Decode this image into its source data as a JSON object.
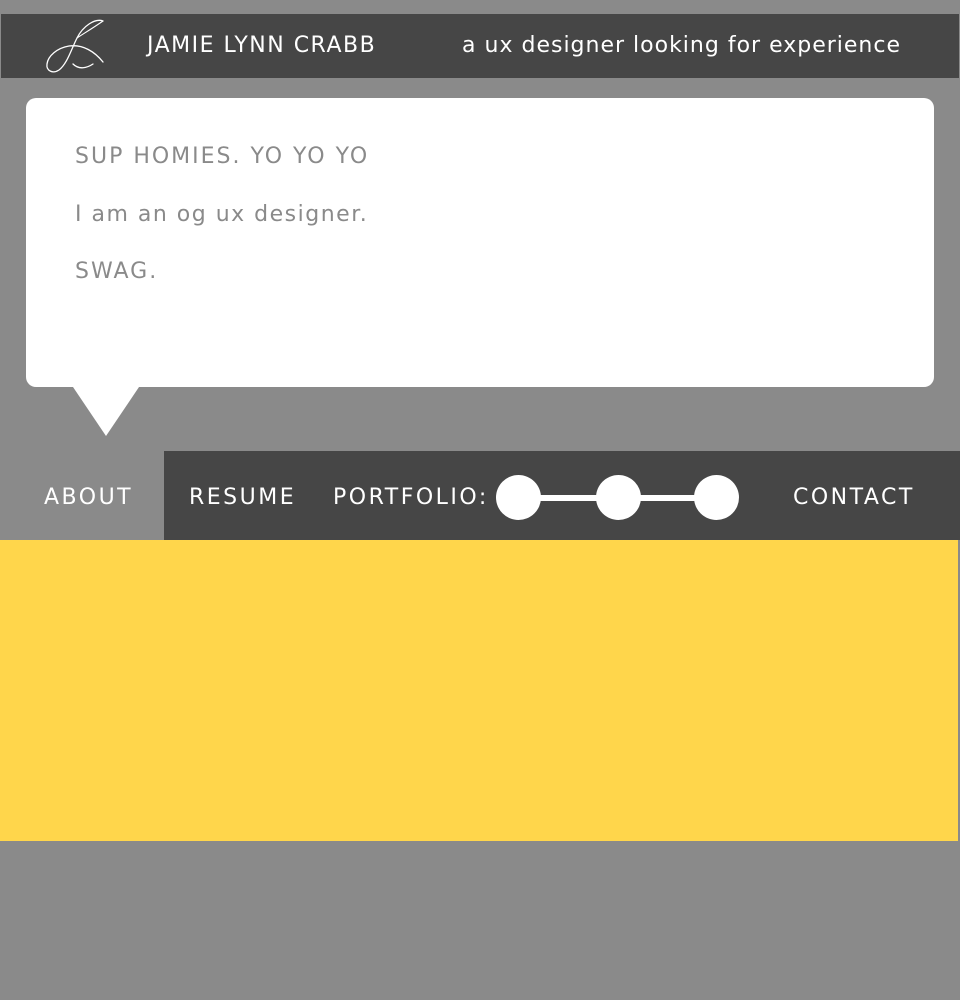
{
  "header": {
    "logo": "script-L-monogram",
    "site_name": "JAMIE LYNN CRABB",
    "tagline": "a ux designer looking for experience"
  },
  "bubble": {
    "line1": "SUP HOMIES. YO YO YO",
    "line2": "I am an og ux designer.",
    "line3": "SWAG."
  },
  "nav": {
    "about": "ABOUT",
    "resume": "RESUME",
    "portfolio": "PORTFOLIO:",
    "portfolio_slides": 3,
    "contact": "CONTACT"
  },
  "colors": {
    "page_background": "#8a8a8a",
    "dark_bar": "#464646",
    "bubble": "#ffffff",
    "accent_yellow": "#ffd64b",
    "text_light": "#ffffff",
    "text_grey": "#8a8a8a"
  }
}
